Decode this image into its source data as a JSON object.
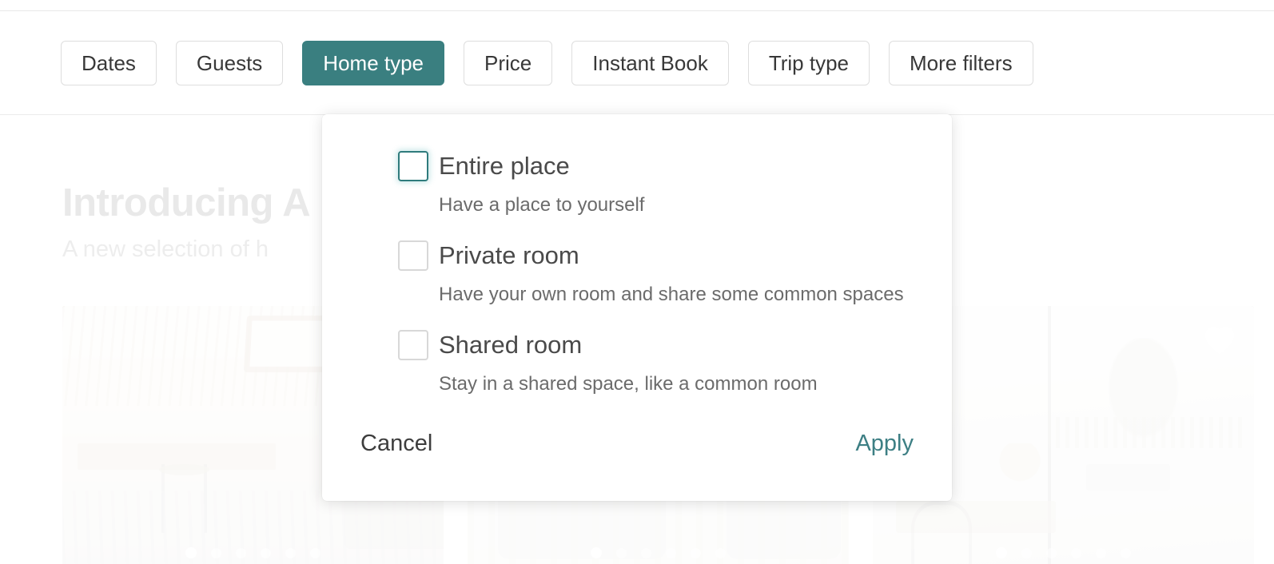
{
  "filter_bar": {
    "pills": [
      {
        "label": "Dates",
        "active": false
      },
      {
        "label": "Guests",
        "active": false
      },
      {
        "label": "Home type",
        "active": true
      },
      {
        "label": "Price",
        "active": false
      },
      {
        "label": "Instant Book",
        "active": false
      },
      {
        "label": "Trip type",
        "active": false
      },
      {
        "label": "More filters",
        "active": false
      }
    ]
  },
  "page": {
    "hero_title": "Introducing A",
    "hero_subtitle": "A new selection of h"
  },
  "cards": [
    {
      "name": "listing-card-1",
      "dots": 6,
      "active_dot": 0,
      "favorite": false
    },
    {
      "name": "listing-card-2",
      "dots": 6,
      "active_dot": 0,
      "favorite": false
    },
    {
      "name": "listing-card-3",
      "dots": 6,
      "active_dot": 0,
      "favorite": true
    }
  ],
  "modal": {
    "options": [
      {
        "label": "Entire place",
        "description": "Have a place to yourself",
        "checked": false,
        "focused": true
      },
      {
        "label": "Private room",
        "description": "Have your own room and share some common spaces",
        "checked": false,
        "focused": false
      },
      {
        "label": "Shared room",
        "description": "Stay in a shared space, like a common room",
        "checked": false,
        "focused": false
      }
    ],
    "cancel_label": "Cancel",
    "apply_label": "Apply"
  },
  "colors": {
    "accent_teal": "#3a7f80",
    "apply_teal": "#3d7f84",
    "pill_border": "#dedede",
    "text_primary": "#383838",
    "text_secondary": "#6b6b6b"
  }
}
